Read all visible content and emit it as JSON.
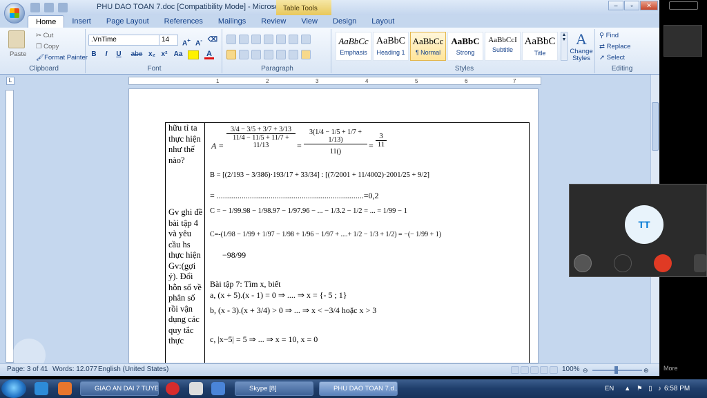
{
  "window": {
    "title": "PHU DAO TOAN 7.doc [Compatibility Mode] - Microsoft W...",
    "context_tab": "Table Tools"
  },
  "tabs": [
    "Home",
    "Insert",
    "Page Layout",
    "References",
    "Mailings",
    "Review",
    "View",
    "Design",
    "Layout"
  ],
  "ribbon": {
    "clipboard": {
      "paste": "Paste",
      "cut": "Cut",
      "copy": "Copy",
      "format_painter": "Format Painter",
      "name": "Clipboard"
    },
    "font": {
      "family": ".VnTime",
      "size": "14",
      "name": "Font",
      "bold": "B",
      "italic": "I",
      "underline": "U",
      "strike": "abe",
      "sub": "x₂",
      "sup": "x²",
      "case": "Aa"
    },
    "paragraph": {
      "name": "Paragraph"
    },
    "styles": {
      "name": "Styles",
      "items": [
        {
          "preview": "AaBbCc",
          "label": "Emphasis"
        },
        {
          "preview": "AaBbC",
          "label": "Heading 1"
        },
        {
          "preview": "AaBbCc",
          "label": "¶ Normal"
        },
        {
          "preview": "AaBbC",
          "label": "Strong"
        },
        {
          "preview": "AaBbCcI",
          "label": "Subtitle"
        },
        {
          "preview": "AaBbC",
          "label": "Title"
        }
      ],
      "change_styles": "Change Styles"
    },
    "editing": {
      "find": "Find",
      "replace": "Replace",
      "select": "Select",
      "name": "Editing"
    }
  },
  "ruler": [
    "1",
    "2",
    "3",
    "4",
    "5",
    "6",
    "7"
  ],
  "doc": {
    "left_cells": [
      "hữu tỉ ta thực hiện như thế nào?",
      "Gv ghi đề bài tập 4 và yêu cầu hs thực hiện Gv:(gợi ý). Đổi hỗn số về phân số rồi vận dụng các quy tắc thực"
    ],
    "lines": {
      "a_label": "A =",
      "a_num": "3/4 − 3/5 + 3/7 + 3/13",
      "a_den": "11/4 − 11/5 + 11/7 + 11/13",
      "a_mid_num": "3(1/4 − 1/5 + 1/7 + 1/13)",
      "a_mid_den": "11()",
      "a_res_num": "3",
      "a_res_den": "11",
      "b_line": "B = [(2/193 − 3/386)·193/17 + 33/34] : [(7/2001 + 11/4002)·2001/25 + 9/2]",
      "b_res": "= .......................................................................=0,2",
      "c1": "C = − 1/99.98 − 1/98.97 − 1/97.96 − ... − 1/3.2 − 1/2 = ... = 1/99 − 1",
      "c2": "C=-(1/98 − 1/99 + 1/97 − 1/98 + 1/96 − 1/97 + ....+ 1/2 − 1/3 + 1/2) = −(− 1/99 + 1)",
      "c3": "−98/99",
      "bt7": "Bài tập 7: Tìm x, biết",
      "pa": "a, (x + 5).(x - 1) = 0 ⇒ .... ⇒ x = {- 5 ; 1}",
      "pb": "b, (x - 3).(x + 3/4) > 0 ⇒ ... ⇒ x < −3/4 hoặc x > 3",
      "pc": "c, |x−5| = 5 ⇒ ... ⇒ x = 10, x = 0"
    }
  },
  "status": {
    "page": "Page: 3 of 41",
    "words": "Words: 12.077",
    "lang": "English (United States)",
    "zoom": "100%"
  },
  "skype": {
    "initials": "TT"
  },
  "taskbar": {
    "apps": [
      "GIAO AN DAI 7 TUYE...",
      "Skype [8]",
      "PHU DAO TOAN 7.d..."
    ],
    "lang": "EN",
    "clock": "6:58 PM",
    "more": "More"
  },
  "colors": {
    "ribbon_bg": "#dae6f5",
    "accent": "#15428b",
    "taskbar": "#1f3e6b",
    "skype_end": "#e03a24"
  }
}
